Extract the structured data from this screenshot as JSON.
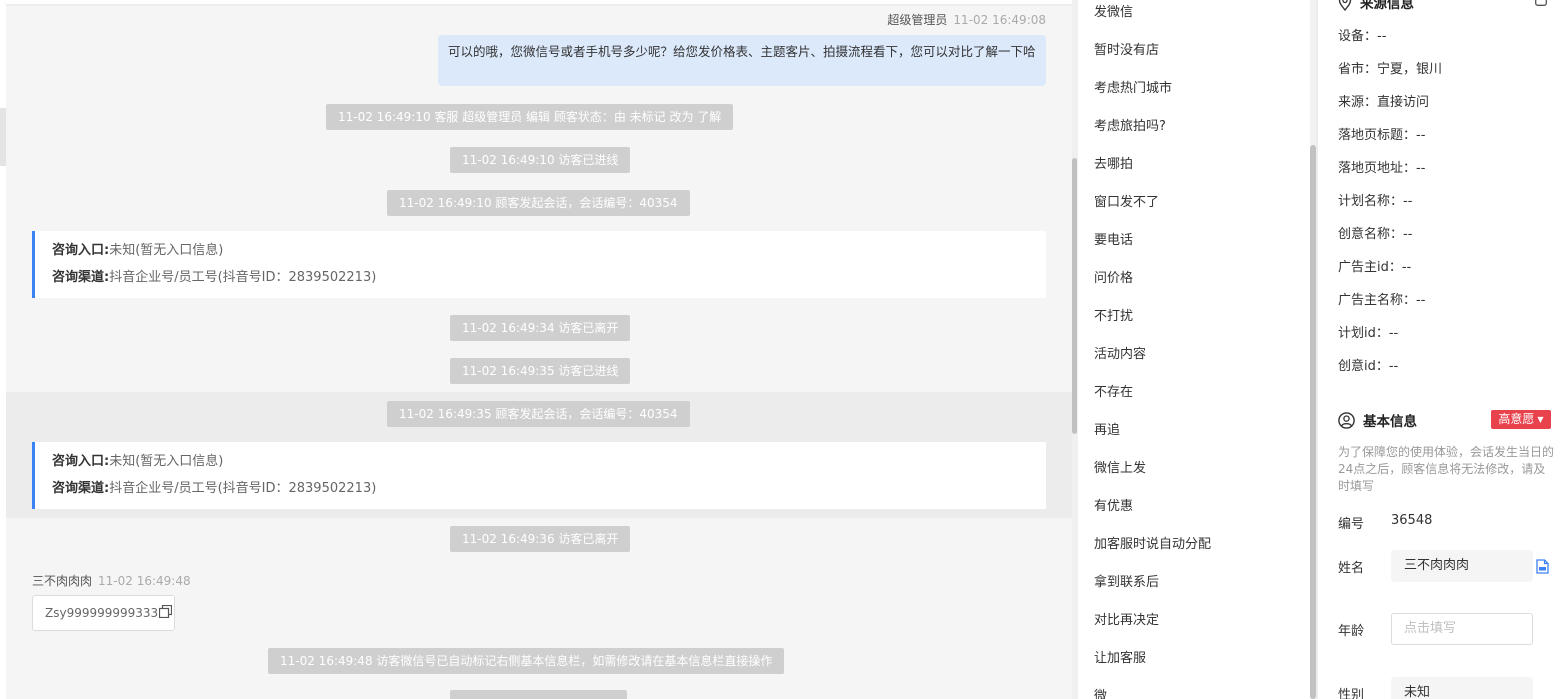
{
  "chat": {
    "header_msg": {
      "sender": "超级管理员",
      "time": "11-02 16:49:08",
      "text": "可以的哦，您微信号或者手机号多少呢？给您发价格表、主题客片、拍摄流程看下，您可以对比了解一下哈"
    },
    "sys1": "11-02 16:49:10 客服 超级管理员 编辑 顾客状态：由 未标记 改为 了解",
    "sys2": "11-02 16:49:10 访客已进线",
    "sys3": "11-02 16:49:10 顾客发起会话，会话编号：40354",
    "card1": {
      "entry_label": "咨询入口:",
      "entry_value": "未知(暂无入口信息)",
      "channel_label": "咨询渠道:",
      "channel_value": "抖音企业号/员工号(抖音号ID：2839502213)"
    },
    "sys4": "11-02 16:49:34 访客已离开",
    "sys5": "11-02 16:49:35 访客已进线",
    "sys6": "11-02 16:49:35 顾客发起会话，会话编号：40354",
    "card2": {
      "entry_label": "咨询入口:",
      "entry_value": "未知(暂无入口信息)",
      "channel_label": "咨询渠道:",
      "channel_value": "抖音企业号/员工号(抖音号ID：2839502213)"
    },
    "sys7": "11-02 16:49:36 访客已离开",
    "visitor_msg": {
      "sender": "三不肉肉肉",
      "time": "11-02 16:49:48",
      "text": "Zsy999999999333"
    },
    "sys8": "11-02 16:49:48 访客微信号已自动标记右侧基本信息栏，如需修改请在基本信息栏直接操作"
  },
  "quick_replies": [
    "发微信",
    "暂时没有店",
    "考虑热门城市",
    "考虑旅拍吗?",
    "去哪拍",
    "窗口发不了",
    "要电话",
    "问价格",
    "不打扰",
    "活动内容",
    "不存在",
    "再追",
    "微信上发",
    "有优惠",
    "加客服时说自动分配",
    "拿到联系后",
    "对比再决定",
    "让加客服",
    "微"
  ],
  "source_info": {
    "title": "来源信息",
    "rows": [
      "设备：--",
      "省市：宁夏，银川",
      "来源：直接访问",
      "落地页标题：--",
      "落地页地址：--",
      "计划名称：--",
      "创意名称：--",
      "广告主id：--",
      "广告主名称：--",
      "计划id：--",
      "创意id：--"
    ]
  },
  "basic_info": {
    "title": "基本信息",
    "intent_badge": "高意愿",
    "tip": "为了保障您的使用体验，会话发生当日的24点之后，顾客信息将无法修改，请及时填写",
    "id_label": "编号",
    "id_value": "36548",
    "name_label": "姓名",
    "name_value": "三不肉肉肉",
    "age_label": "年龄",
    "age_placeholder": "点击填写",
    "gender_label": "性别",
    "gender_value": "未知"
  },
  "colors": {
    "accent": "#3b82f6",
    "bubble": "#dce9fb",
    "system_pill": "#cfcfcf",
    "badge": "#e8424d"
  },
  "icons": [
    "copy-icon",
    "location-icon",
    "user-circle-icon",
    "caret-down-icon",
    "edit-icon",
    "minimize-icon"
  ]
}
